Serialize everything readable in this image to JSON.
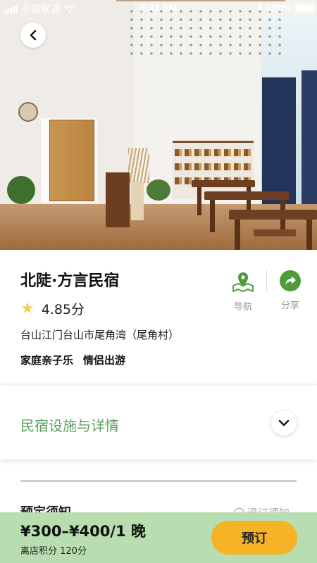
{
  "status_bar": {
    "carrier": "中国联通",
    "time": "9:41 AM",
    "battery_text": "100%"
  },
  "hero": {
    "back_icon": "chevron-left-icon"
  },
  "listing": {
    "title": "北陡·方言民宿",
    "rating": "4.85分",
    "address": "台山江门台山市尾角湾（尾角村）",
    "tags": [
      "家庭亲子乐",
      "情侣出游"
    ]
  },
  "actions": {
    "navigate_label": "导航",
    "share_label": "分享",
    "accent_color": "#4f9a3a"
  },
  "details": {
    "label": "民宿设施与详情"
  },
  "booking_notice": {
    "title": "预定须知",
    "refund_label": "退订须知"
  },
  "bottom_bar": {
    "price": "¥300–¥400/1 晚",
    "points": "离店积分 120分",
    "book_label": "预订",
    "button_color": "#f6b326",
    "bar_color": "#b7ddb0"
  }
}
